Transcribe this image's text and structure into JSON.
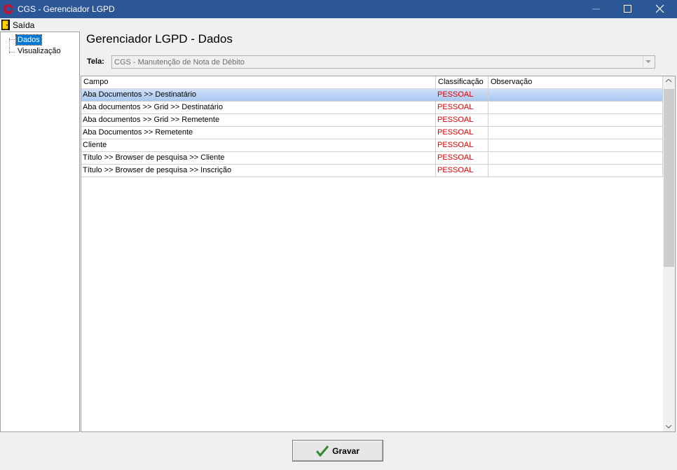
{
  "window": {
    "title": "CGS - Gerenciador LGPD",
    "app_icon": "cgs-logo-icon"
  },
  "menu": {
    "saida_label": "Saída",
    "saida_icon": "exit-door-icon"
  },
  "tree": {
    "items": [
      {
        "label": "Dados",
        "selected": true
      },
      {
        "label": "Visualização",
        "selected": false
      }
    ]
  },
  "main": {
    "heading": "Gerenciador LGPD - Dados",
    "tela_label": "Tela:",
    "tela_value": "CGS - Manutenção de Nota de Débito"
  },
  "grid": {
    "columns": [
      "Campo",
      "Classificação",
      "Observação"
    ],
    "rows": [
      {
        "campo": "Aba Documentos >> Destinatário",
        "classificacao": "PESSOAL",
        "observacao": ""
      },
      {
        "campo": "Aba documentos >> Grid  >> Destinatário",
        "classificacao": "PESSOAL",
        "observacao": ""
      },
      {
        "campo": "Aba documentos >> Grid  >> Remetente",
        "classificacao": "PESSOAL",
        "observacao": ""
      },
      {
        "campo": "Aba Documentos >> Remetente",
        "classificacao": "PESSOAL",
        "observacao": ""
      },
      {
        "campo": "Cliente",
        "classificacao": "PESSOAL",
        "observacao": ""
      },
      {
        "campo": "Título >> Browser de pesquisa >> Cliente",
        "classificacao": "PESSOAL",
        "observacao": ""
      },
      {
        "campo": "Título >> Browser de pesquisa >> Inscrição",
        "classificacao": "PESSOAL",
        "observacao": ""
      }
    ],
    "selected_row": 0
  },
  "footer": {
    "gravar_label": "Gravar",
    "gravar_icon": "checkmark-icon"
  },
  "colors": {
    "titlebar": "#2b5797",
    "selection": "#0078d7",
    "classification_text": "#e00000"
  }
}
